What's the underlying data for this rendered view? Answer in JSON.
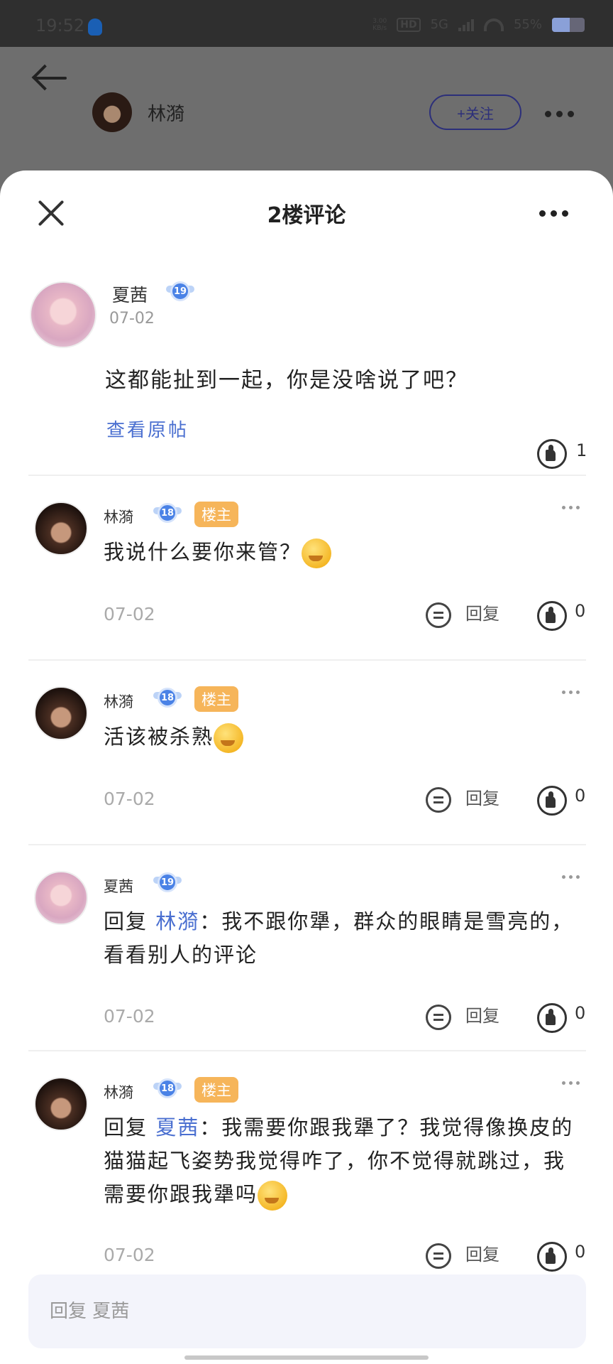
{
  "status_bar": {
    "time": "19:52",
    "net_speed_top": "3.00",
    "net_speed_bottom": "KB/s",
    "hd_label": "HD",
    "network": "5G",
    "battery": "55%",
    "battery_level": 0.55
  },
  "header": {
    "name": "林漪",
    "follow_label": "+关注"
  },
  "sheet": {
    "title": "2楼评论"
  },
  "main_comment": {
    "author": "夏茜",
    "level": "19",
    "date": "07-02",
    "text": "这都能扯到一起，你是没啥说了吧？",
    "view_original": "查看原帖",
    "likes": "1"
  },
  "replies": [
    {
      "author": "林漪",
      "level": "18",
      "owner_badge": "楼主",
      "text": "我说什么要你来管？",
      "emoji": "face-emoji",
      "date": "07-02",
      "reply_label": "回复",
      "likes": "0"
    },
    {
      "author": "林漪",
      "level": "18",
      "owner_badge": "楼主",
      "text": "活该被杀熟",
      "emoji": "face-emoji",
      "date": "07-02",
      "reply_label": "回复",
      "likes": "0"
    },
    {
      "author": "夏茜",
      "level": "19",
      "prefix": "回复",
      "mention": "林漪",
      "text": "：我不跟你犟，群众的眼睛是雪亮的，看看别人的评论",
      "date": "07-02",
      "reply_label": "回复",
      "likes": "0"
    },
    {
      "author": "林漪",
      "level": "18",
      "owner_badge": "楼主",
      "prefix": "回复",
      "mention": "夏茜",
      "text": "：我需要你跟我犟了？我觉得像换皮的猫猫起飞姿势我觉得咋了，你不觉得就跳过，我需要你跟我犟吗",
      "emoji": "face-emoji",
      "date": "07-02",
      "reply_label": "回复",
      "likes": "0"
    }
  ],
  "input": {
    "placeholder": "回复 夏茜"
  },
  "colors": {
    "accent": "#4a6fd0",
    "owner_badge": "#f6b55a",
    "level_badge": "#4a82e6"
  }
}
